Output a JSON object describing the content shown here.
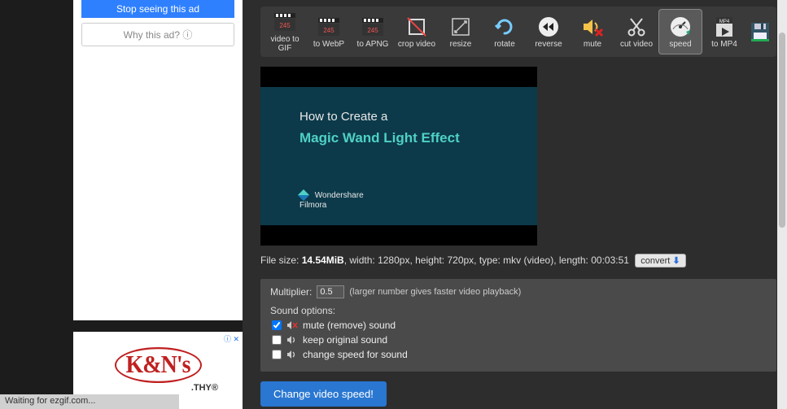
{
  "sidebar": {
    "stop_ad": "Stop seeing this ad",
    "why_ad": "Why this ad? ⓘ",
    "ad_brand_text": "K&N's",
    "ad_sub": ".THY®"
  },
  "toolbar": {
    "items": [
      {
        "label": "video to GIF"
      },
      {
        "label": "to WebP"
      },
      {
        "label": "to APNG"
      },
      {
        "label": "crop video"
      },
      {
        "label": "resize"
      },
      {
        "label": "rotate"
      },
      {
        "label": "reverse"
      },
      {
        "label": "mute"
      },
      {
        "label": "cut video"
      },
      {
        "label": "speed"
      },
      {
        "label": "to MP4"
      }
    ]
  },
  "preview": {
    "line1": "How to Create a",
    "line2": "Magic Wand Light Effect",
    "brand1": "Wondershare",
    "brand2": "Filmora"
  },
  "fileinfo": {
    "prefix": "File size: ",
    "size": "14.54MiB",
    "rest": ", width: 1280px, height: 720px, type: mkv (video), length: 00:03:51",
    "convert": "convert"
  },
  "options": {
    "mult_label": "Multiplier:",
    "mult_value": "0.5",
    "mult_hint": "(larger number gives faster video playback)",
    "sound_hdr": "Sound options:",
    "opt_mute": "mute (remove) sound",
    "opt_keep": "keep original sound",
    "opt_change": "change speed for sound"
  },
  "submit": {
    "label": "Change video speed!"
  },
  "status": {
    "text": "Waiting for ezgif.com..."
  }
}
